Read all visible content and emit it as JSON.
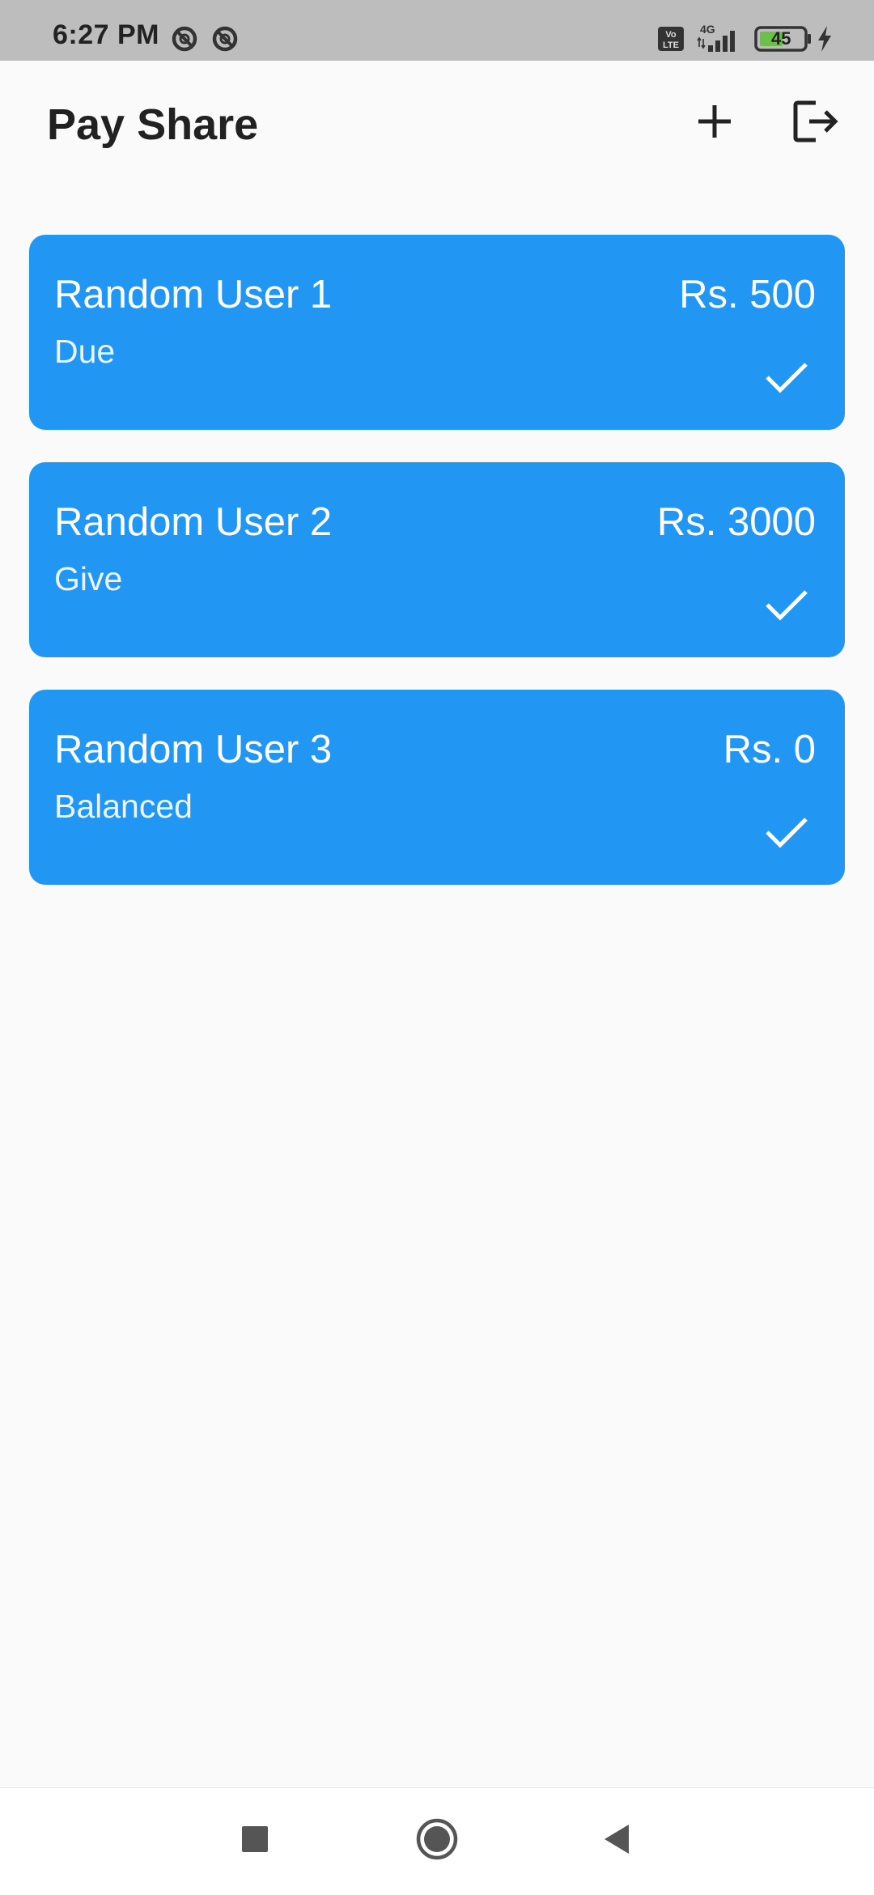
{
  "status_bar": {
    "time": "6:27 PM",
    "network_type": "4G",
    "volte_label": "Vo LTE",
    "battery_level": "45",
    "icons": [
      "do-not-disturb-icon",
      "do-not-disturb-icon",
      "volte-icon",
      "signal-icon",
      "battery-icon",
      "charging-icon"
    ]
  },
  "app_bar": {
    "title": "Pay Share",
    "actions": [
      "add-icon",
      "logout-icon"
    ]
  },
  "colors": {
    "card_background": "#2196f3",
    "card_text": "#ffffff",
    "page_background": "#fafafa",
    "status_bar_background": "#bdbdbd",
    "battery_fill": "#6cc04a"
  },
  "users": [
    {
      "name": "Random User 1",
      "status": "Due",
      "amount": "Rs. 500"
    },
    {
      "name": "Random User 2",
      "status": "Give",
      "amount": "Rs. 3000"
    },
    {
      "name": "Random User 3",
      "status": "Balanced",
      "amount": "Rs. 0"
    }
  ],
  "nav_bar": {
    "buttons": [
      "recents-icon",
      "home-icon",
      "back-icon"
    ]
  }
}
